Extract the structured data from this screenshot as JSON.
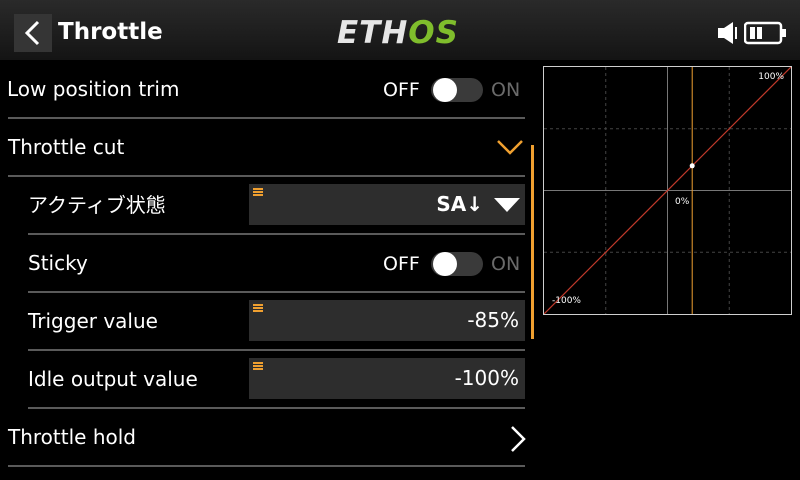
{
  "header": {
    "title": "Throttle",
    "logo_main": "ETH",
    "logo_accent": "OS"
  },
  "rows": {
    "low_position_trim": {
      "label": "Low position trim",
      "off": "OFF",
      "on": "ON",
      "state": "off"
    },
    "throttle_cut": {
      "label": "Throttle cut",
      "expanded": true
    },
    "active_condition": {
      "label": "アクティブ状態",
      "value": "SA↓"
    },
    "sticky": {
      "label": "Sticky",
      "off": "OFF",
      "on": "ON",
      "state": "off"
    },
    "trigger_value": {
      "label": "Trigger value",
      "value": "-85%"
    },
    "idle_output_value": {
      "label": "Idle output value",
      "value": "-100%"
    },
    "throttle_hold": {
      "label": "Throttle hold"
    }
  },
  "graph": {
    "top_right_label": "100%",
    "center_label": "0%",
    "bottom_left_label": "-100%",
    "curve_color": "#c0392b",
    "marker_color": "#f0a030",
    "input_position": 0.2
  },
  "colors": {
    "accent": "#f0a030",
    "logo_green": "#7fbd2c"
  }
}
